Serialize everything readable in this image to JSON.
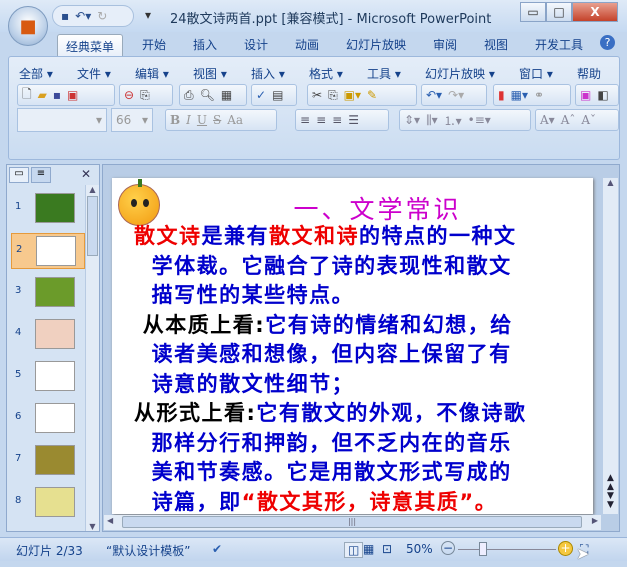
{
  "window": {
    "title": "24散文诗两首.ppt [兼容模式] - Microsoft PowerPoint",
    "minimize": "▭",
    "maximize": "□",
    "close": "X"
  },
  "tabs": [
    "经典菜单",
    "开始",
    "插入",
    "设计",
    "动画",
    "幻灯片放映",
    "审阅",
    "视图",
    "开发工具"
  ],
  "menus": [
    "全部",
    "文件",
    "编辑",
    "视图",
    "插入",
    "格式",
    "工具",
    "幻灯片放映",
    "窗口",
    "帮助"
  ],
  "font_size": "66",
  "format_buttons": [
    "B",
    "I",
    "U",
    "S",
    "Aa"
  ],
  "slide_numbers": [
    "1",
    "2",
    "3",
    "4",
    "5",
    "6",
    "7",
    "8"
  ],
  "selected_slide": 2,
  "slide": {
    "title": "一、文学常识",
    "lines": [
      [
        {
          "t": "散文诗",
          "c": "r"
        },
        {
          "t": "是兼有",
          "c": ""
        },
        {
          "t": "散文和诗",
          "c": "r"
        },
        {
          "t": "的特点的一种文",
          "c": ""
        }
      ],
      [
        {
          "t": "  学体裁。它融合了诗的表现性和散文",
          "c": ""
        }
      ],
      [
        {
          "t": "  描写性的某些特点。",
          "c": ""
        }
      ],
      [
        {
          "t": " 从本质上看:",
          "c": "k"
        },
        {
          "t": "它有诗的情绪和幻想，给",
          "c": ""
        }
      ],
      [
        {
          "t": "  读者美感和想像，但内容上保留了有",
          "c": ""
        }
      ],
      [
        {
          "t": "  诗意的散文性细节；",
          "c": ""
        }
      ],
      [
        {
          "t": "从形式上看:",
          "c": "k"
        },
        {
          "t": "它有散文的外观，不像诗歌",
          "c": ""
        }
      ],
      [
        {
          "t": "  那样分行和押韵，但不乏内在的音乐",
          "c": ""
        }
      ],
      [
        {
          "t": "  美和节奏感。它是用散文形式写成的",
          "c": ""
        }
      ],
      [
        {
          "t": "  诗篇，即",
          "c": ""
        },
        {
          "t": "“散文其形，诗意其质”。",
          "c": "r"
        }
      ]
    ]
  },
  "status": {
    "slide": "幻灯片 2/33",
    "theme": "“默认设计模板”",
    "zoom": "50%",
    "zoom_level_percent": 50
  }
}
